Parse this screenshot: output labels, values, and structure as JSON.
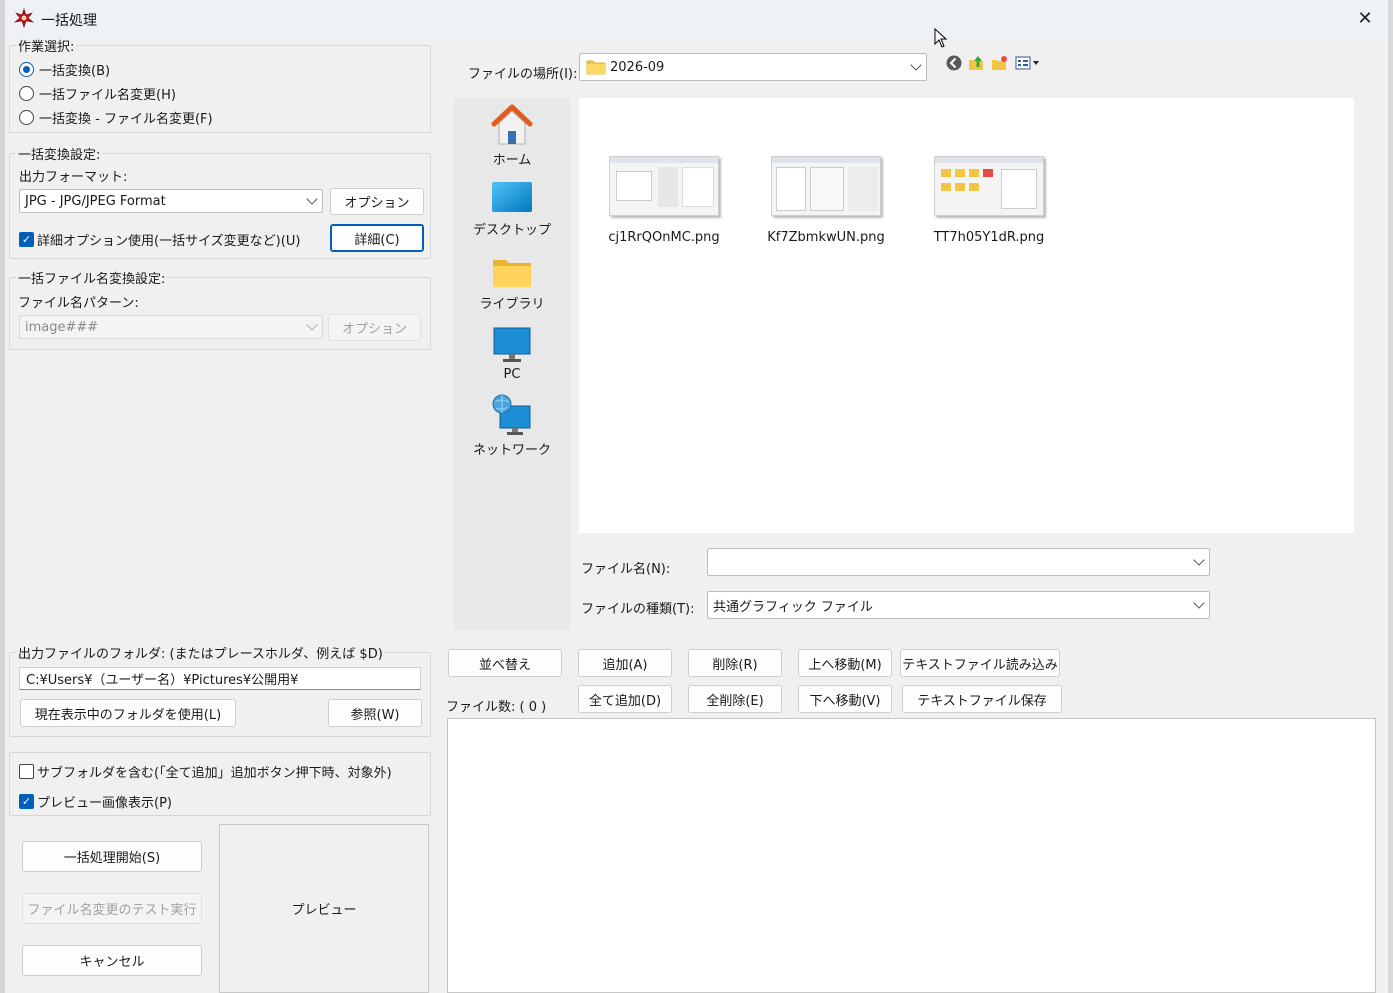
{
  "window": {
    "title": "一括処理",
    "close": "✕"
  },
  "task": {
    "title": "作業選択:",
    "options": [
      {
        "label": "一括変換(B)",
        "selected": true
      },
      {
        "label": "一括ファイル名変更(H)",
        "selected": false
      },
      {
        "label": "一括変換 - ファイル名変更(F)",
        "selected": false
      }
    ]
  },
  "convert": {
    "title": "一括変換設定:",
    "format_label": "出力フォーマット:",
    "format_value": "JPG - JPG/JPEG Format",
    "option_button": "オプション",
    "advanced_check": "詳細オプション使用(一括サイズ変更など)(U)",
    "advanced_checked": true,
    "detail_button": "詳細(C)"
  },
  "rename": {
    "title": "一括ファイル名変換設定:",
    "pattern_label": "ファイル名パターン:",
    "pattern_value": "image###",
    "option_button": "オプション"
  },
  "output": {
    "folder_label": "出力ファイルのフォルダ: (またはプレースホルダ、例えば $D)",
    "folder_value": "C:¥Users¥（ユーザー名）¥Pictures¥公開用¥",
    "use_current_button": "現在表示中のフォルダを使用(L)",
    "browse_button": "参照(W)"
  },
  "options2": {
    "subfolder_check": "サブフォルダを含む(「全て追加」追加ボタン押下時、対象外)",
    "subfolder_checked": false,
    "preview_check": "プレビュー画像表示(P)",
    "preview_checked": true
  },
  "actions": {
    "start_button": "一括処理開始(S)",
    "test_button": "ファイル名変更のテスト実行",
    "cancel_button": "キャンセル",
    "preview_label": "プレビュー"
  },
  "browser": {
    "location_label": "ファイルの場所(I):",
    "location_value": "2026-09",
    "toolbar_icons": [
      "back-icon",
      "up-folder-icon",
      "new-folder-icon",
      "view-menu-icon"
    ],
    "places": [
      {
        "label": "ホーム",
        "icon": "home-icon"
      },
      {
        "label": "デスクトップ",
        "icon": "desktop-icon"
      },
      {
        "label": "ライブラリ",
        "icon": "library-icon"
      },
      {
        "label": "PC",
        "icon": "pc-icon"
      },
      {
        "label": "ネットワーク",
        "icon": "network-icon"
      }
    ],
    "files": [
      {
        "name": "cj1RrQOnMC.png"
      },
      {
        "name": "Kf7ZbmkwUN.png"
      },
      {
        "name": "TT7h05Y1dR.png"
      }
    ],
    "filename_label": "ファイル名(N):",
    "filename_value": "",
    "filetype_label": "ファイルの種類(T):",
    "filetype_value": "共通グラフィック ファイル"
  },
  "list": {
    "sort_button": "並べ替え",
    "add_button": "追加(A)",
    "remove_button": "削除(R)",
    "move_up_button": "上へ移動(M)",
    "load_text_button": "テキストファイル読み込み",
    "file_count_label": "ファイル数: ( 0 )",
    "add_all_button": "全て追加(D)",
    "remove_all_button": "全削除(E)",
    "move_down_button": "下へ移動(V)",
    "save_text_button": "テキストファイル保存"
  },
  "colors": {
    "accent": "#005fb8",
    "background": "#f0f0f0",
    "title_bar": "#eef1f6"
  }
}
